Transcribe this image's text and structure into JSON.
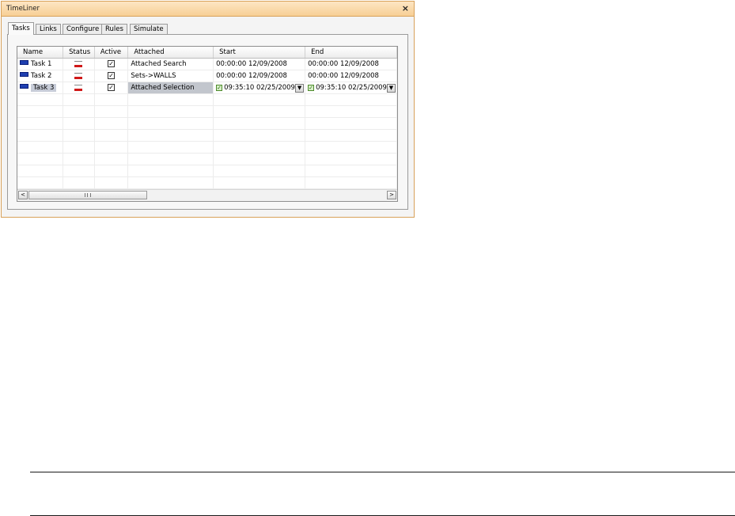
{
  "window": {
    "title": "TimeLiner",
    "close_glyph": "×"
  },
  "tabs": [
    {
      "label": "Tasks",
      "active": true
    },
    {
      "label": "Links",
      "active": false
    },
    {
      "label": "Configure",
      "active": false
    },
    {
      "label": "Rules",
      "active": false
    },
    {
      "label": "Simulate",
      "active": false
    }
  ],
  "grid": {
    "columns": [
      "Name",
      "Status",
      "Active",
      "Attached",
      "Start",
      "End"
    ],
    "rows": [
      {
        "name": "Task 1",
        "status_icon": "status-bar-icon",
        "active": true,
        "attached": "Attached Search",
        "start": "00:00:00 12/09/2008",
        "end": "00:00:00 12/09/2008"
      },
      {
        "name": "Task 2",
        "status_icon": "status-bar-icon",
        "active": true,
        "attached": "Sets->WALLS",
        "start": "00:00:00 12/09/2008",
        "end": "00:00:00 12/09/2008"
      },
      {
        "name": "Task 3",
        "status_icon": "status-bar-icon",
        "active": true,
        "attached": "Attached Selection",
        "start": "09:35:10 02/25/2009",
        "end": "09:35:10 02/25/2009",
        "selected": true,
        "start_checked": true,
        "end_checked": true
      }
    ],
    "empty_row_count": 8,
    "colors": {
      "task_icon": "#1f3fb0",
      "status_red": "#d01818",
      "selection": "#c2c6cd"
    }
  },
  "scrollbar": {
    "left_arrow": "<",
    "right_arrow": ">"
  }
}
